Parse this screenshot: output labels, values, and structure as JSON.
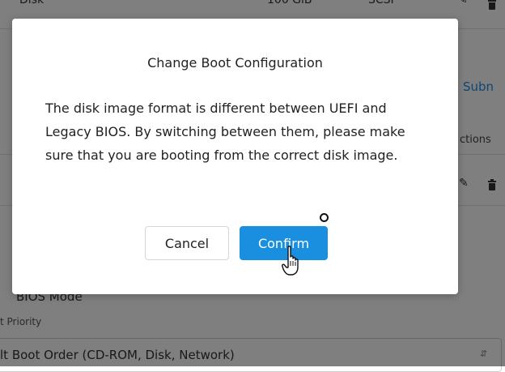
{
  "background": {
    "row_top": {
      "name": "Disk",
      "size": "100 GiB",
      "bus": "SCSI"
    },
    "subnet_link": "Subn",
    "actions_header": "ctions",
    "bios_mode_label": "BIOS Mode",
    "boot_priority_label": "t Priority",
    "boot_order_select": {
      "value": "lt Boot Order (CD-ROM, Disk, Network)"
    }
  },
  "dialog": {
    "title": "Change Boot Configuration",
    "body": "The disk image format is different between UEFI and Legacy BIOS. By switching between them, please make sure that you are booting from the correct disk image.",
    "cancel_label": "Cancel",
    "confirm_label": "Confirm"
  },
  "colors": {
    "primary": "#1a8fe0",
    "overlay": "rgba(0,0,0,0.5)"
  }
}
